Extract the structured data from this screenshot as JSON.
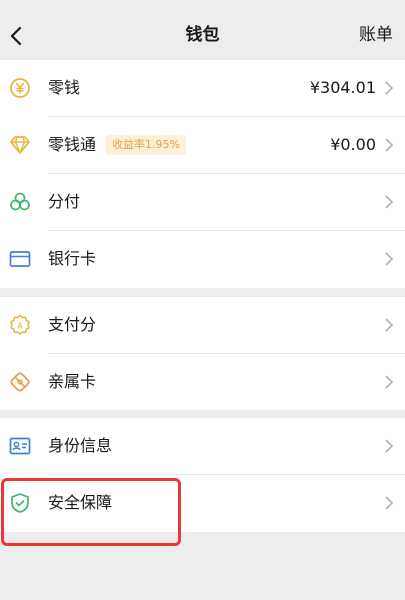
{
  "nav": {
    "title": "钱包",
    "bill": "账单"
  },
  "items": {
    "change": {
      "label": "零钱",
      "value": "¥304.01"
    },
    "change_plus": {
      "label": "零钱通",
      "badge": "收益率1.95%",
      "value": "¥0.00"
    },
    "fenfu": {
      "label": "分付"
    },
    "bank_card": {
      "label": "银行卡"
    },
    "pay_score": {
      "label": "支付分"
    },
    "family_card": {
      "label": "亲属卡"
    },
    "identity": {
      "label": "身份信息"
    },
    "security": {
      "label": "安全保障"
    }
  },
  "colors": {
    "gold": "#e8b53a",
    "green": "#3fb76b",
    "blue": "#3f7de0",
    "orange": "#e89a4a",
    "highlight": "#e53935"
  },
  "icons": {
    "change": "yen-coin-icon",
    "change_plus": "diamond-icon",
    "fenfu": "clover-icon",
    "bank_card": "card-icon",
    "pay_score": "badge-icon",
    "family_card": "family-card-icon",
    "identity": "id-card-icon",
    "security": "shield-icon"
  }
}
